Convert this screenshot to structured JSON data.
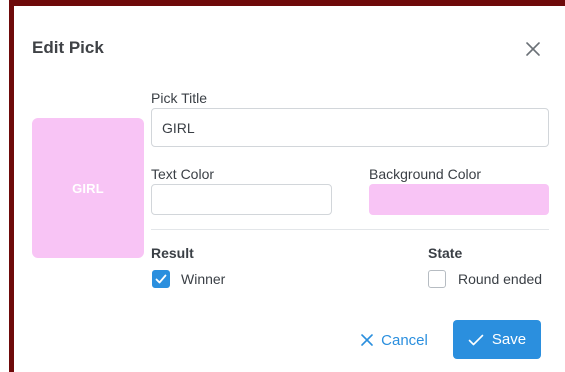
{
  "dialog": {
    "title": "Edit Pick"
  },
  "preview": {
    "text": "GIRL",
    "background_color": "#f8c4f5",
    "text_color": "#ffffff"
  },
  "fields": {
    "pick_title": {
      "label": "Pick Title",
      "value": "GIRL"
    },
    "text_color": {
      "label": "Text Color",
      "value": ""
    },
    "background_color": {
      "label": "Background Color",
      "swatch": "#f8c4f5"
    }
  },
  "result": {
    "label": "Result",
    "option_label": "Winner",
    "checked": true
  },
  "state": {
    "label": "State",
    "option_label": "Round ended",
    "checked": false
  },
  "buttons": {
    "cancel_label": "Cancel",
    "save_label": "Save"
  },
  "icons": {
    "close": "close-icon",
    "cancel": "x-icon",
    "save": "check-icon",
    "checkbox": "checkmark-icon"
  },
  "colors": {
    "accent": "#2b8fde",
    "frame": "#6e0a0a"
  }
}
